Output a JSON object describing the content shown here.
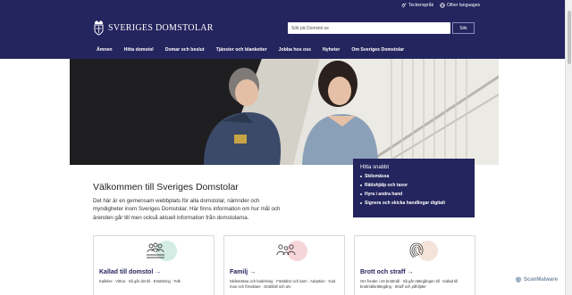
{
  "utility": {
    "sign_language": "Teckenspråk",
    "other_languages": "Other languages"
  },
  "brand": {
    "name": "SVERIGES DOMSTOLAR"
  },
  "search": {
    "placeholder": "Sök på Domstol.se",
    "button": "Sök"
  },
  "nav": [
    "Ämnen",
    "Hitta domstol",
    "Domar och beslut",
    "Tjänster och blanketter",
    "Jobba hos oss",
    "Nyheter",
    "Om Sveriges Domstolar"
  ],
  "quick": {
    "title": "Hitta snabbt",
    "items": [
      "Skilsmässa",
      "Rättshjälp och taxor",
      "Hyra i andra hand",
      "Signera och skicka handlingar digitalt"
    ]
  },
  "welcome": {
    "title": "Välkommen till Sveriges Domstolar",
    "intro": "Det här är en gemensam webbplats för alla domstolar, nämnder och myndigheter inom Sveriges Domstolar. Här finns information om hur mål och ärenden går till men också aktuell information från domstolarna."
  },
  "cards": [
    {
      "title": "Kallad till domstol",
      "text": "Kallelse · Vittna · Så går det till · Ersättning · Tolk",
      "color": "#d3ece4",
      "icon": "people-group-icon"
    },
    {
      "title": "Familj",
      "text": "Skilsmässa och bodelning · Föräldrar och barn · Adoption · God man och förvaltare · Dödsfall och arv",
      "color": "#f6d5d9",
      "icon": "family-icon"
    },
    {
      "title": "Brott och straff",
      "text": "Om fonder i ett brottmål · Så går rättegången till · Kallad till brottmålsrättegång · Straff och påföljder",
      "color": "#f3e3d9",
      "icon": "fingerprint-icon"
    }
  ],
  "watermark": "ScanMalware",
  "colors": {
    "brand_navy": "#24245e",
    "accent": "#2d2a7a"
  }
}
